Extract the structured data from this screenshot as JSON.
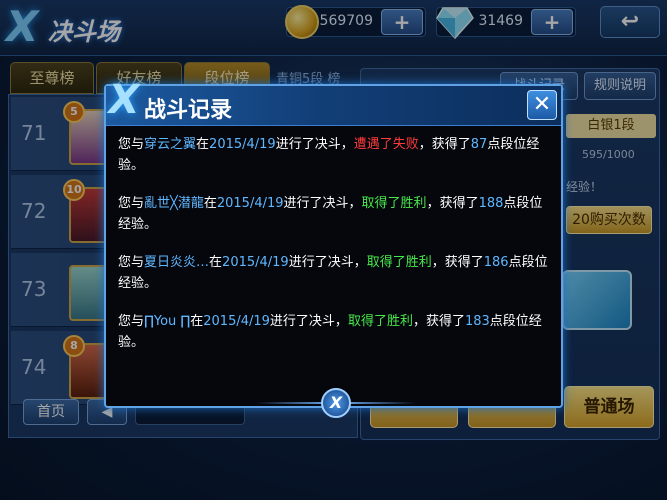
{
  "header": {
    "logo_mark": "X",
    "logo_text": "决斗场",
    "coins": "569709",
    "gems": "31469",
    "plus_label": "+",
    "back_label": "↩"
  },
  "tabs": [
    {
      "label": "至尊榜"
    },
    {
      "label": "好友榜"
    },
    {
      "label": "段位榜"
    }
  ],
  "tab_sub": "青铜5段 榜",
  "ranks": [
    {
      "num": "71",
      "badge": "5"
    },
    {
      "num": "72",
      "badge": "10"
    },
    {
      "num": "73",
      "badge": ""
    },
    {
      "num": "74",
      "badge": "8"
    }
  ],
  "bottom_left": {
    "home_label": "首页",
    "prev_label": "◀"
  },
  "right_panel": {
    "record_label": "战斗记录",
    "rules_label": "规则说明",
    "tier": "白银1段",
    "tier_progress": "595/1000",
    "tier_progress_fraction": 0.595,
    "exp_text": "经验！",
    "buy_label": "20购买次数",
    "normal_label": "普通场"
  },
  "modal": {
    "logo_mark": "X",
    "title": "战斗记录",
    "close_label": "✕",
    "footer_mark": "X",
    "records": [
      {
        "prefix": "您与",
        "opponent": "穿云之翼",
        "mid": "在",
        "date": "2015/4/19",
        "mid2": "进行了决斗，",
        "result": "遭遇了失败",
        "result_type": "lose",
        "gain": "，获得了",
        "points": "87",
        "suffix": "点段位经验。"
      },
      {
        "prefix": "您与",
        "opponent": "亂世╳潜龍",
        "mid": "在",
        "date": "2015/4/19",
        "mid2": "进行了决斗，",
        "result": "取得了胜利",
        "result_type": "win",
        "gain": "，获得了",
        "points": "188",
        "suffix": "点段位经验。"
      },
      {
        "prefix": "您与",
        "opponent": "夏日炎炎…",
        "mid": "在",
        "date": "2015/4/19",
        "mid2": "进行了决斗，",
        "result": "取得了胜利",
        "result_type": "win",
        "gain": "，获得了",
        "points": "186",
        "suffix": "点段位经验。"
      },
      {
        "prefix": "您与",
        "opponent": "∏You ∏",
        "mid": "在",
        "date": "2015/4/19",
        "mid2": "进行了决斗，",
        "result": "取得了胜利",
        "result_type": "win",
        "gain": "，获得了",
        "points": "183",
        "suffix": "点段位经验。"
      }
    ]
  },
  "colors": {
    "opponent": "#5fb7ff",
    "win": "#47e84b",
    "lose": "#ff3b3b"
  }
}
